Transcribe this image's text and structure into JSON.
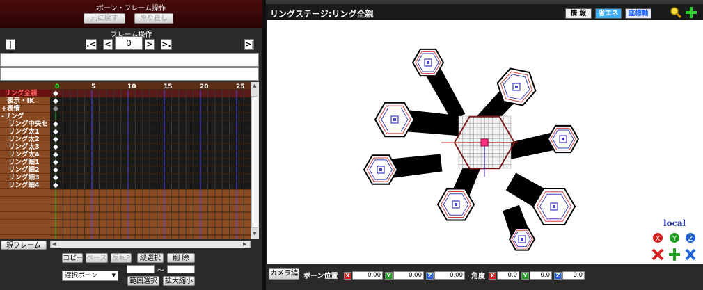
{
  "left_panel": {
    "bone_frame_title": "ボーン・フレーム操作",
    "undo_label": "元に戻す",
    "redo_label": "やり直し",
    "frame_ops_title": "フレーム操作",
    "nav": {
      "first": "|<",
      "prev_key": ".<",
      "prev": "<",
      "frame_value": "0",
      "next": ">",
      "next_key": ">.",
      "last": ">|"
    },
    "ruler_ticks": [
      "0",
      "5",
      "10",
      "15",
      "20",
      "25"
    ],
    "bones": [
      {
        "label": "リング全親",
        "color": "#ff6060",
        "indent": 6,
        "key": "diamond-white"
      },
      {
        "label": "表示・IK",
        "color": "#ffffff",
        "indent": 10,
        "key": "diamond-white"
      },
      {
        "label": "+表情",
        "color": "#ffffff",
        "indent": 2,
        "key": "diamond-gray"
      },
      {
        "label": "-リング",
        "color": "#ffffff",
        "indent": 2,
        "key": "none"
      },
      {
        "label": "リング中央セ",
        "color": "#ffffff",
        "indent": 12,
        "key": "diamond-white"
      },
      {
        "label": "リング太1",
        "color": "#ffffff",
        "indent": 12,
        "key": "diamond-white"
      },
      {
        "label": "リング太2",
        "color": "#ffffff",
        "indent": 12,
        "key": "diamond-white"
      },
      {
        "label": "リング太3",
        "color": "#ffffff",
        "indent": 12,
        "key": "diamond-white"
      },
      {
        "label": "リング太4",
        "color": "#ffffff",
        "indent": 12,
        "key": "diamond-white"
      },
      {
        "label": "リング細1",
        "color": "#ffffff",
        "indent": 12,
        "key": "diamond-white"
      },
      {
        "label": "リング細2",
        "color": "#ffffff",
        "indent": 12,
        "key": "diamond-white"
      },
      {
        "label": "リング細3",
        "color": "#ffffff",
        "indent": 12,
        "key": "diamond-white"
      },
      {
        "label": "リング細4",
        "color": "#ffffff",
        "indent": 12,
        "key": "diamond-white"
      }
    ],
    "current_frame_btn": "現フレーム",
    "copy": "コピー",
    "paste": "ペースト",
    "flip_paste": "反転P",
    "vertical_select": "縦選択",
    "delete": "削 除",
    "range_tilde": "～",
    "bone_select_value": "選択ボーン",
    "range_select": "範囲選択",
    "scale": "拡大縮小"
  },
  "viewport": {
    "title": "リングステージ:リング全親",
    "info": "情 報",
    "eco": "省エネ",
    "axis": "座標軸",
    "local": "local",
    "colors": {
      "accent": "#3bd6ff",
      "eco_bg": "#3bb0ff",
      "axis_bg": "#e8e8ff"
    }
  },
  "bottom_bar": {
    "camera_edit": "カメラ編",
    "bone_position": "ボーン位置",
    "angle": "角度",
    "pos": {
      "x": "0.00",
      "y": "0.00",
      "z": "0.00"
    },
    "rot": {
      "x": "0.0",
      "y": "0.0",
      "z": "0.0"
    },
    "x": "X",
    "y": "Y",
    "z": "Z"
  }
}
